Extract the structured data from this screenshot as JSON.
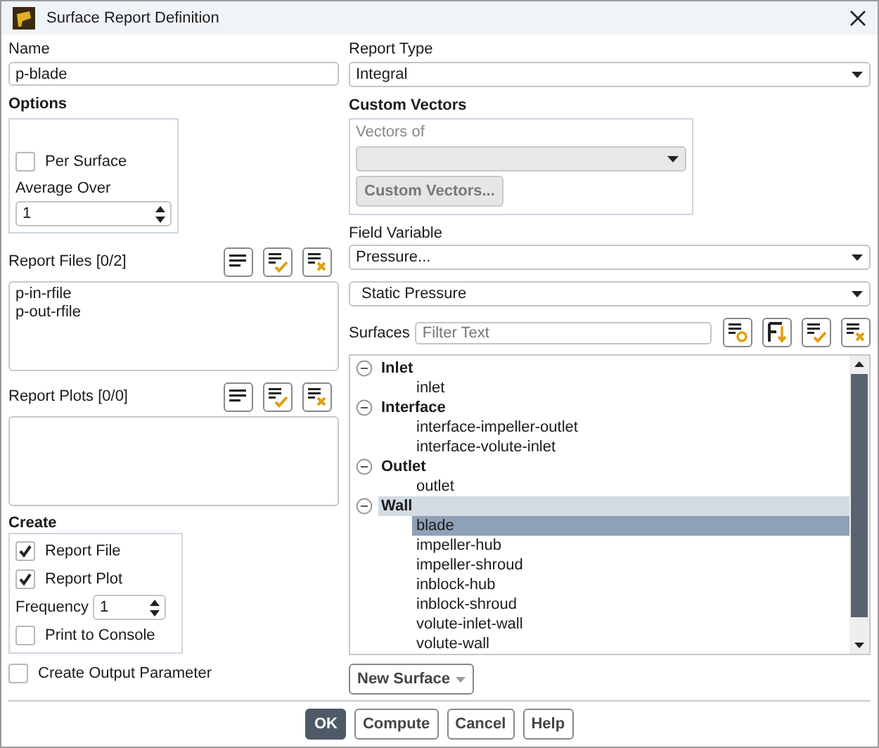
{
  "window": {
    "title": "Surface Report Definition"
  },
  "name": {
    "label": "Name",
    "value": "p-blade"
  },
  "options": {
    "title": "Options",
    "per_surface": {
      "label": "Per Surface",
      "checked": false
    },
    "average_over": {
      "label": "Average Over",
      "value": "1"
    }
  },
  "report_files": {
    "label": "Report Files",
    "count": "[0/2]",
    "items": [
      {
        "label": "p-in-rfile",
        "selected": false
      },
      {
        "label": "p-out-rfile",
        "selected": false
      }
    ]
  },
  "report_plots": {
    "label": "Report Plots",
    "count": "[0/0]"
  },
  "create": {
    "title": "Create",
    "items": [
      {
        "kind": "checkbox",
        "label": "Report File",
        "checked": true
      },
      {
        "kind": "checkbox",
        "label": "Report Plot",
        "checked": true
      },
      {
        "kind": "spinner",
        "label": "Frequency",
        "value": "1"
      },
      {
        "kind": "checkbox",
        "label": "Print to Console",
        "checked": false
      }
    ]
  },
  "create_output_parameter": {
    "label": "Create Output Parameter",
    "checked": false
  },
  "report_type": {
    "label": "Report Type",
    "value": "Integral"
  },
  "custom_vectors": {
    "title": "Custom Vectors",
    "vectors_of": {
      "label": "Vectors of",
      "disabled": true
    },
    "button": {
      "label": "Custom Vectors...",
      "disabled": true
    }
  },
  "field_variable": {
    "label": "Field Variable",
    "category": "Pressure...",
    "value": "Static Pressure"
  },
  "surfaces": {
    "label": "Surfaces",
    "placeholder": "Filter Text",
    "groups": [
      {
        "label": "Inlet",
        "expanded": true,
        "selected": false,
        "children": [
          {
            "label": "inlet",
            "selected": false
          }
        ]
      },
      {
        "label": "Interface",
        "expanded": true,
        "selected": false,
        "children": [
          {
            "label": "interface-impeller-outlet",
            "selected": false
          },
          {
            "label": "interface-volute-inlet",
            "selected": false
          }
        ]
      },
      {
        "label": "Outlet",
        "expanded": true,
        "selected": false,
        "children": [
          {
            "label": "outlet",
            "selected": false
          }
        ]
      },
      {
        "label": "Wall",
        "expanded": true,
        "selected": true,
        "children": [
          {
            "label": "blade",
            "selected": true
          },
          {
            "label": "impeller-hub",
            "selected": false
          },
          {
            "label": "impeller-shroud",
            "selected": false
          },
          {
            "label": "inblock-hub",
            "selected": false
          },
          {
            "label": "inblock-shroud",
            "selected": false
          },
          {
            "label": "volute-inlet-wall",
            "selected": false
          },
          {
            "label": "volute-wall",
            "selected": false
          }
        ]
      }
    ]
  },
  "new_surface": {
    "label": "New Surface"
  },
  "buttons": [
    {
      "label": "OK",
      "default": true
    },
    {
      "label": "Compute",
      "default": false
    },
    {
      "label": "Cancel",
      "default": false
    },
    {
      "label": "Help",
      "default": false
    }
  ]
}
